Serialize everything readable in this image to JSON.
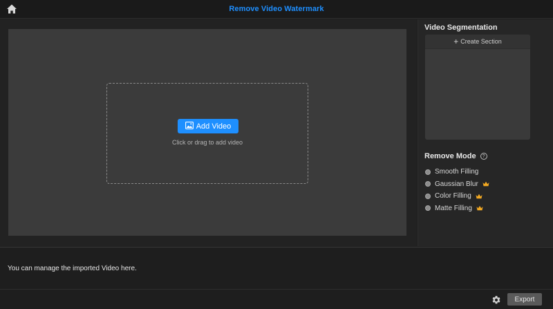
{
  "titlebar": {
    "title": "Remove Video Watermark",
    "home_icon": "home-icon"
  },
  "colors": {
    "accent": "#1e8fff",
    "preview_bg": "#3b3b3b",
    "crown": "#f0a722"
  },
  "preview": {
    "add_video_label": "Add Video",
    "add_video_icon": "image-add-icon",
    "drop_hint": "Click or drag to add video"
  },
  "sidebar": {
    "segmentation_title": "Video Segmentation",
    "create_section_label": "Create Section",
    "remove_mode_title": "Remove Mode",
    "modes": [
      {
        "label": "Smooth Filling",
        "premium": false
      },
      {
        "label": "Gaussian Blur",
        "premium": true
      },
      {
        "label": "Color Filling",
        "premium": true
      },
      {
        "label": "Matte Filling",
        "premium": true
      }
    ]
  },
  "manage": {
    "text": "You can manage the imported Video here."
  },
  "footer": {
    "export_label": "Export",
    "settings_icon": "gear-icon"
  }
}
